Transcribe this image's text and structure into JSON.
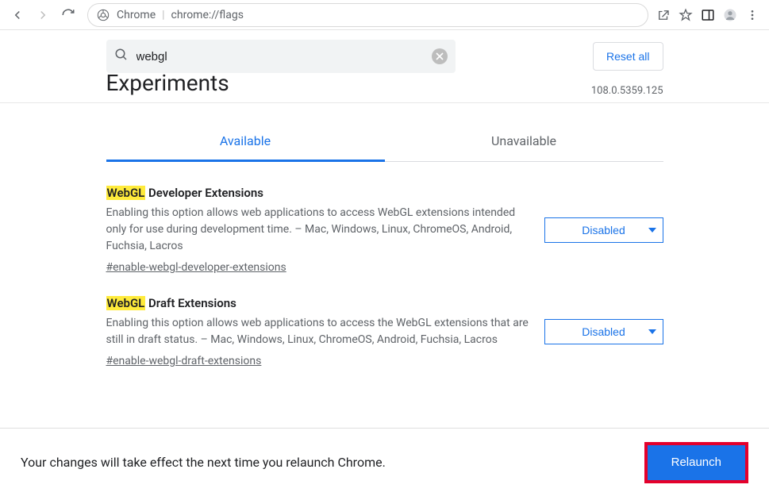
{
  "toolbar": {
    "chrome_label": "Chrome",
    "url": "chrome://flags"
  },
  "search": {
    "value": "webgl"
  },
  "reset_label": "Reset all",
  "page_title": "Experiments",
  "version": "108.0.5359.125",
  "tabs": {
    "available": "Available",
    "unavailable": "Unavailable"
  },
  "flags": [
    {
      "hl": "WebGL",
      "title_rest": " Developer Extensions",
      "desc": "Enabling this option allows web applications to access WebGL extensions intended only for use during development time. – Mac, Windows, Linux, ChromeOS, Android, Fuchsia, Lacros",
      "hash": "#enable-webgl-developer-extensions",
      "value": "Disabled"
    },
    {
      "hl": "WebGL",
      "title_rest": " Draft Extensions",
      "desc": "Enabling this option allows web applications to access the WebGL extensions that are still in draft status. – Mac, Windows, Linux, ChromeOS, Android, Fuchsia, Lacros",
      "hash": "#enable-webgl-draft-extensions",
      "value": "Disabled"
    }
  ],
  "bottom": {
    "text": "Your changes will take effect the next time you relaunch Chrome.",
    "relaunch": "Relaunch"
  }
}
